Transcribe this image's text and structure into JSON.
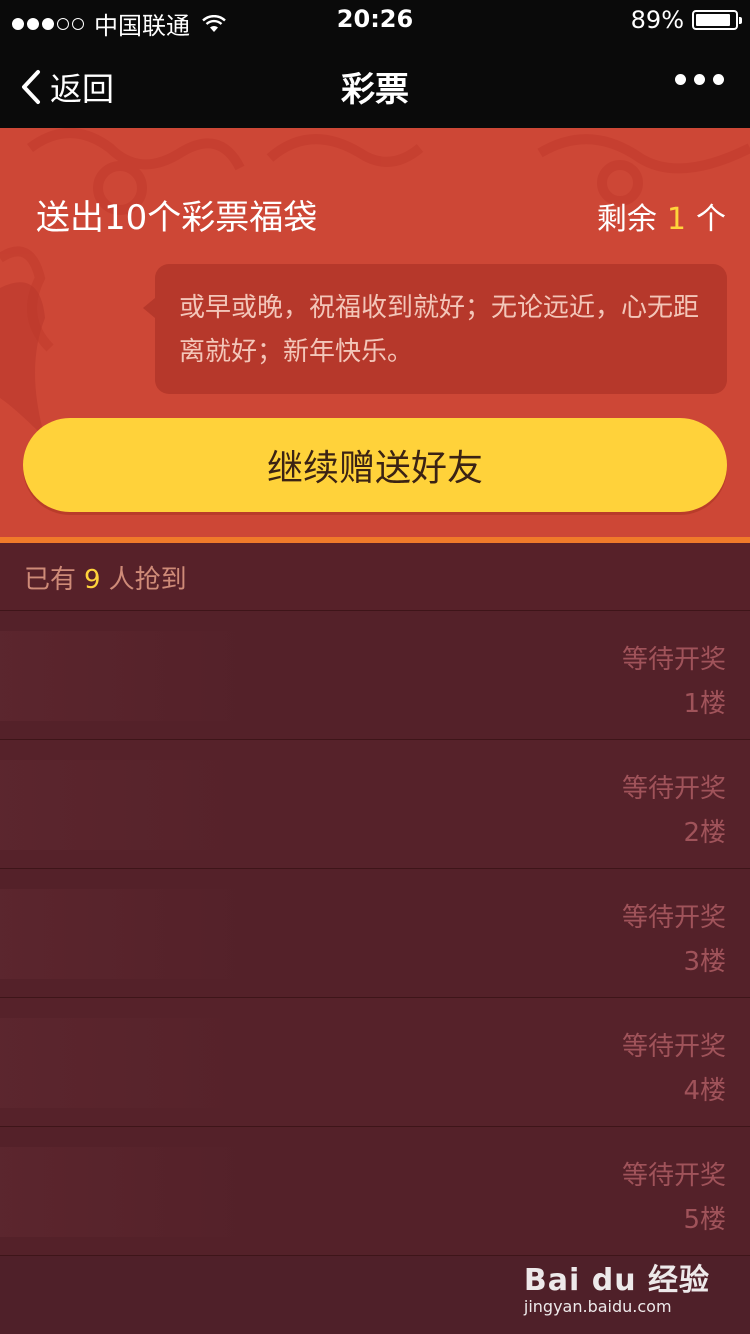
{
  "status_bar": {
    "carrier": "中国联通",
    "time": "20:26",
    "battery": "89%",
    "battery_level": 0.89,
    "signal_bars": 3
  },
  "nav": {
    "back_label": "返回",
    "title": "彩票"
  },
  "hero": {
    "sender_text": "送出10个彩票福袋",
    "remain_prefix": "剩余",
    "remain_count": "1",
    "remain_suffix": "个",
    "message": "或早或晚，祝福收到就好；无论远近，心无距离就好；新年快乐。",
    "cta_label": "继续赠送好友"
  },
  "summary": {
    "prefix": "已有",
    "count": "9",
    "suffix": "人抢到"
  },
  "entries": [
    {
      "status": "等待开奖",
      "floor": "1楼"
    },
    {
      "status": "等待开奖",
      "floor": "2楼"
    },
    {
      "status": "等待开奖",
      "floor": "3楼"
    },
    {
      "status": "等待开奖",
      "floor": "4楼"
    },
    {
      "status": "等待开奖",
      "floor": "5楼"
    }
  ],
  "watermark": {
    "brand": "Bai du 经验",
    "url": "jingyan.baidu.com"
  },
  "colors": {
    "hero_bg": "#cd4736",
    "cta_bg": "#ffd23a",
    "accent_yellow": "#ffd43b",
    "list_bg": "#542129",
    "divider": "#f07a2a"
  }
}
